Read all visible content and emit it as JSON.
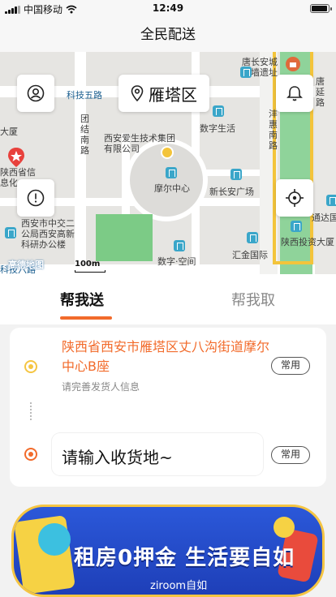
{
  "status_bar": {
    "carrier": "中国移动",
    "time": "12:49",
    "battery_level": 0.95
  },
  "header": {
    "title": "全民配送"
  },
  "map": {
    "district": "雁塔区",
    "labels": {
      "kejiwulu": "科技五路",
      "tuanjienanlu": "团结南路",
      "xianaisheng": "西安爱生技术集团有限公司",
      "shuzishenghuo": "数字生活",
      "tangchangan": "唐长安城城墙遗址",
      "tangyanlu": "唐延路",
      "fuhuilu": "沣惠南路",
      "dasha": "大厦",
      "shaanxixin": "陕西省信息化",
      "moerzhongxin": "摩尔中心",
      "xinchangan": "新长安广场",
      "xianzhongjiao": "西安市中交二公局西安高新科研办公楼",
      "shaanxitouzi": "陕西投资大厦",
      "tongda": "通达国",
      "huijin": "汇金国际",
      "shuzikongjian": "数字·空间",
      "kejiliu": "科技六路",
      "scale": "100m",
      "logo": "高德地图"
    },
    "icons": [
      "user-icon",
      "location-pin-icon",
      "bell-icon",
      "info-icon",
      "crosshair-icon"
    ]
  },
  "tabs": {
    "send": "帮我送",
    "take": "帮我取"
  },
  "sender": {
    "address": "陕西省西安市雁塔区丈八沟街道摩尔中心B座",
    "hint": "请完善发货人信息",
    "common_label": "常用"
  },
  "receiver": {
    "placeholder": "请输入收货地~",
    "common_label": "常用"
  },
  "banner": {
    "headline": "租房0押金 生活要自如",
    "brand": "ziroom自如"
  },
  "colors": {
    "accent": "#f26b2b",
    "sender_dot": "#f5c542",
    "banner_blue": "#2b58d9"
  }
}
